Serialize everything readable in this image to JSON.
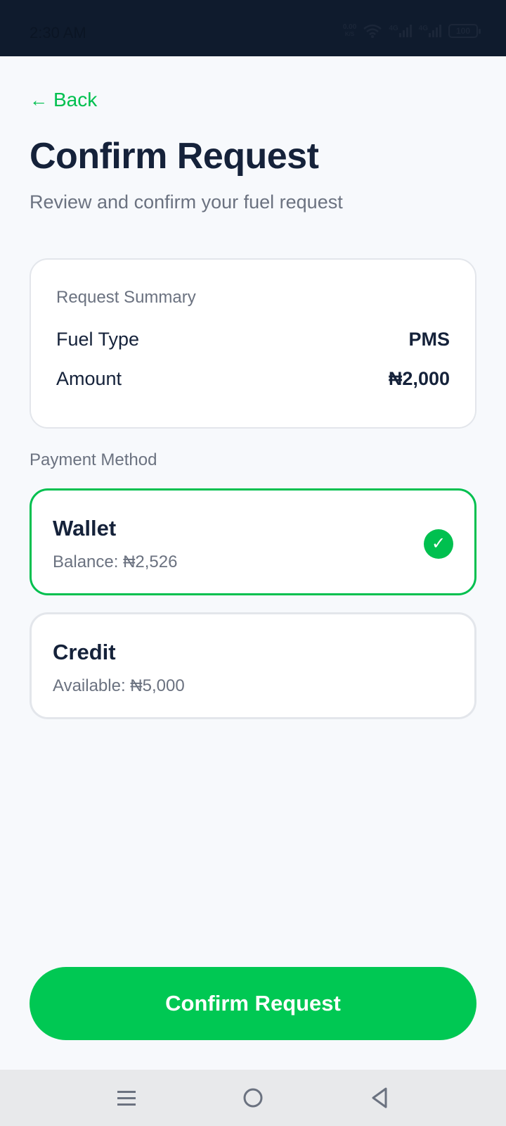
{
  "status_bar": {
    "time": "2:30 AM",
    "net_speed_value": "0.00",
    "net_speed_unit": "K/S",
    "network_1": "4G",
    "network_2": "4G",
    "battery": "100"
  },
  "header": {
    "back_label": "Back",
    "title": "Confirm Request",
    "subtitle": "Review and confirm your fuel request"
  },
  "summary": {
    "label": "Request Summary",
    "rows": [
      {
        "label": "Fuel Type",
        "value": "PMS"
      },
      {
        "label": "Amount",
        "value": "₦2,000"
      }
    ]
  },
  "payment": {
    "section_label": "Payment Method",
    "options": [
      {
        "name": "Wallet",
        "detail": "Balance: ₦2,526",
        "selected": true
      },
      {
        "name": "Credit",
        "detail": "Available: ₦5,000",
        "selected": false
      }
    ]
  },
  "confirm_button_label": "Confirm Request",
  "colors": {
    "accent": "#00c853",
    "title": "#15223a",
    "muted": "#6b7280",
    "statusbar": "#0f1b2d"
  },
  "icons": {
    "back": "arrow-left-icon",
    "selected": "check-icon",
    "nav": [
      "menu-icon",
      "home-icon",
      "back-triangle-icon"
    ]
  }
}
